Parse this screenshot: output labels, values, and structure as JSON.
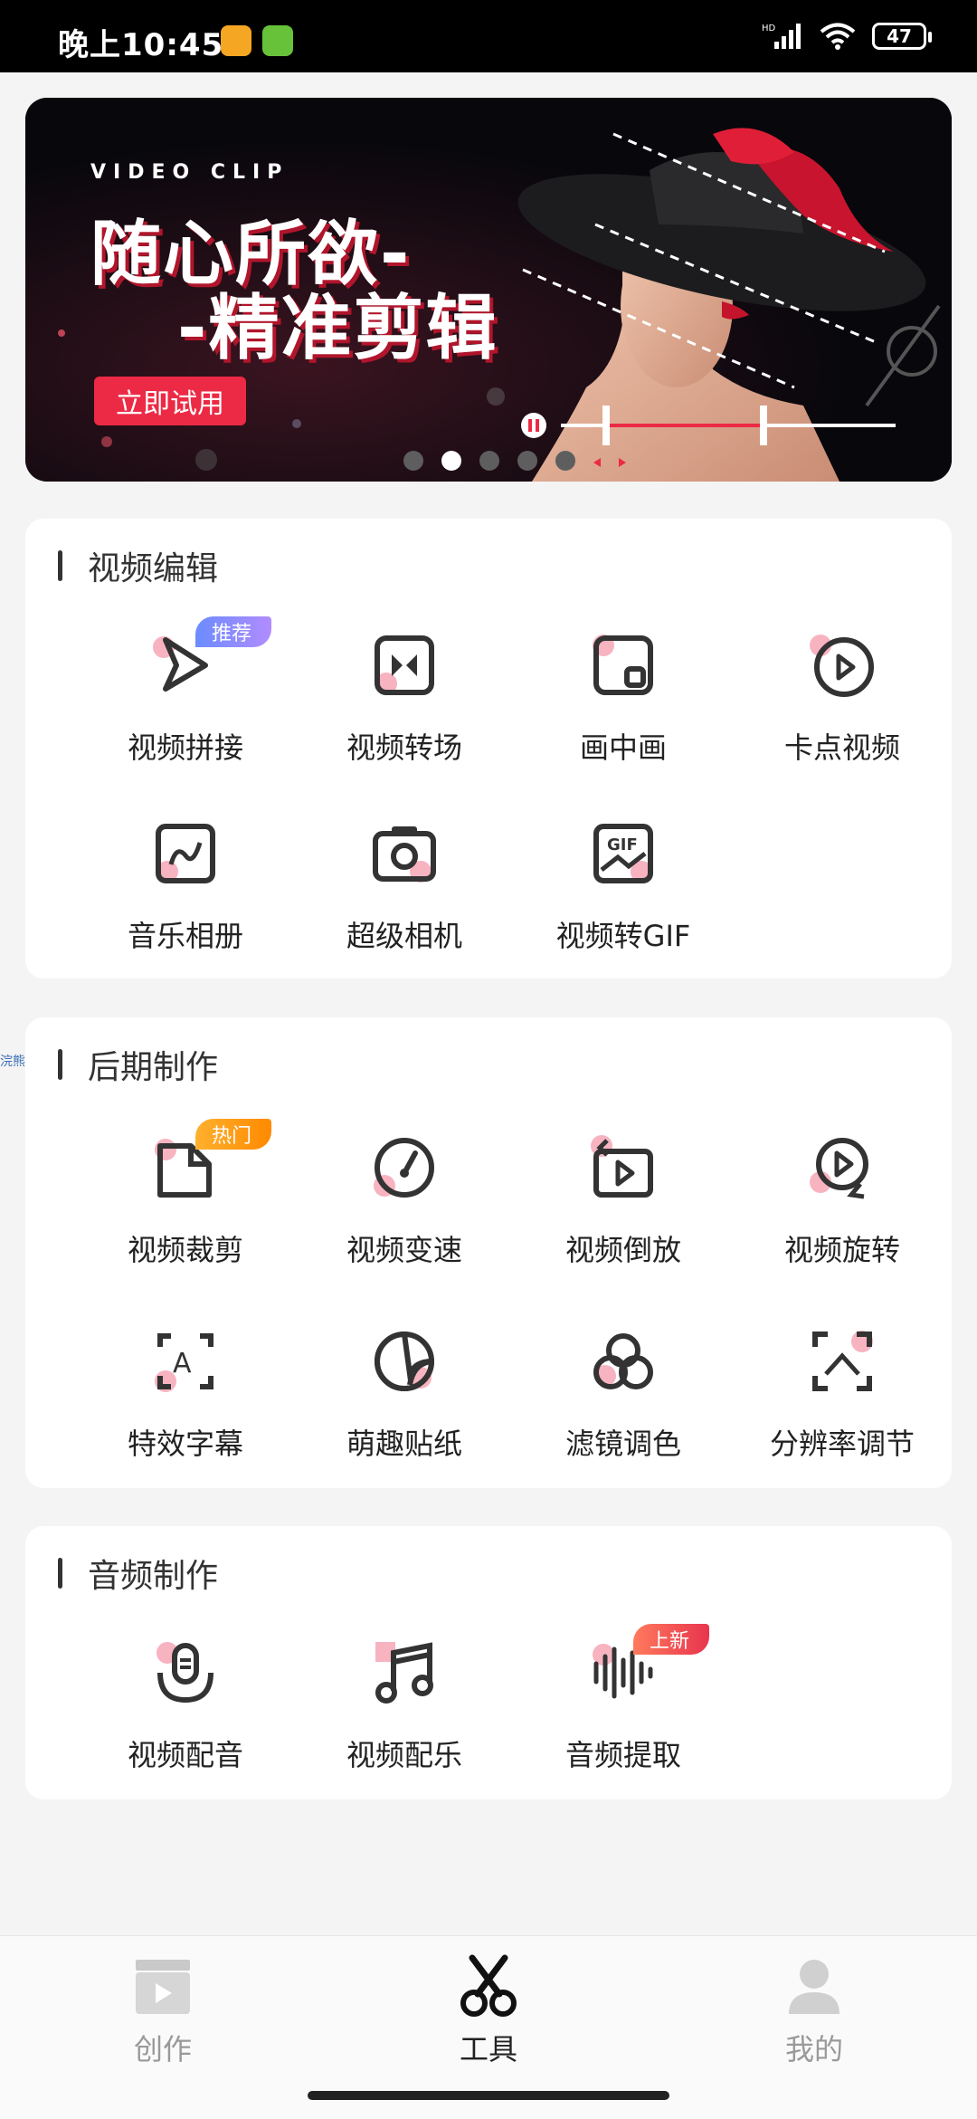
{
  "status": {
    "time": "晚上10:45",
    "battery": "47",
    "signal_label": "HD"
  },
  "banner": {
    "subtitle": "VIDEO CLIP",
    "title_line1": "随心所欲-",
    "title_line2": "-精准剪辑",
    "cta": "立即试用",
    "slides": 5,
    "active_slide": 2
  },
  "sections": {
    "video_edit": {
      "title": "视频编辑",
      "tools": [
        {
          "label": "视频拼接",
          "icon": "play-arrow-icon",
          "tag": "推荐"
        },
        {
          "label": "视频转场",
          "icon": "transition-icon"
        },
        {
          "label": "画中画",
          "icon": "picture-in-picture-icon"
        },
        {
          "label": "卡点视频",
          "icon": "play-circle-icon"
        },
        {
          "label": "音乐相册",
          "icon": "music-album-icon"
        },
        {
          "label": "超级相机",
          "icon": "camera-icon"
        },
        {
          "label": "视频转GIF",
          "icon": "gif-icon"
        }
      ]
    },
    "post_production": {
      "title": "后期制作",
      "tools": [
        {
          "label": "视频裁剪",
          "icon": "crop-file-icon",
          "tag": "热门"
        },
        {
          "label": "视频变速",
          "icon": "speedometer-icon"
        },
        {
          "label": "视频倒放",
          "icon": "reverse-play-icon"
        },
        {
          "label": "视频旋转",
          "icon": "rotate-play-icon"
        },
        {
          "label": "特效字幕",
          "icon": "text-effect-icon"
        },
        {
          "label": "萌趣贴纸",
          "icon": "sticker-icon"
        },
        {
          "label": "滤镜调色",
          "icon": "filter-icon"
        },
        {
          "label": "分辨率调节",
          "icon": "resolution-icon"
        }
      ]
    },
    "audio": {
      "title": "音频制作",
      "tools": [
        {
          "label": "视频配音",
          "icon": "microphone-icon"
        },
        {
          "label": "视频配乐",
          "icon": "music-note-icon"
        },
        {
          "label": "音频提取",
          "icon": "waveform-icon",
          "tag": "上新"
        }
      ]
    }
  },
  "side_label": "浣熊社区",
  "nav": {
    "items": [
      {
        "label": "创作",
        "icon": "clapperboard-icon"
      },
      {
        "label": "工具",
        "icon": "scissors-icon",
        "active": true
      },
      {
        "label": "我的",
        "icon": "profile-icon"
      }
    ]
  },
  "colors": {
    "accent": "#ec2a45",
    "tag_recommend": "#6a8cff",
    "tag_hot": "#ff9a1f",
    "tag_new": "#f05a4b",
    "icon_highlight": "#f7b3c0"
  }
}
